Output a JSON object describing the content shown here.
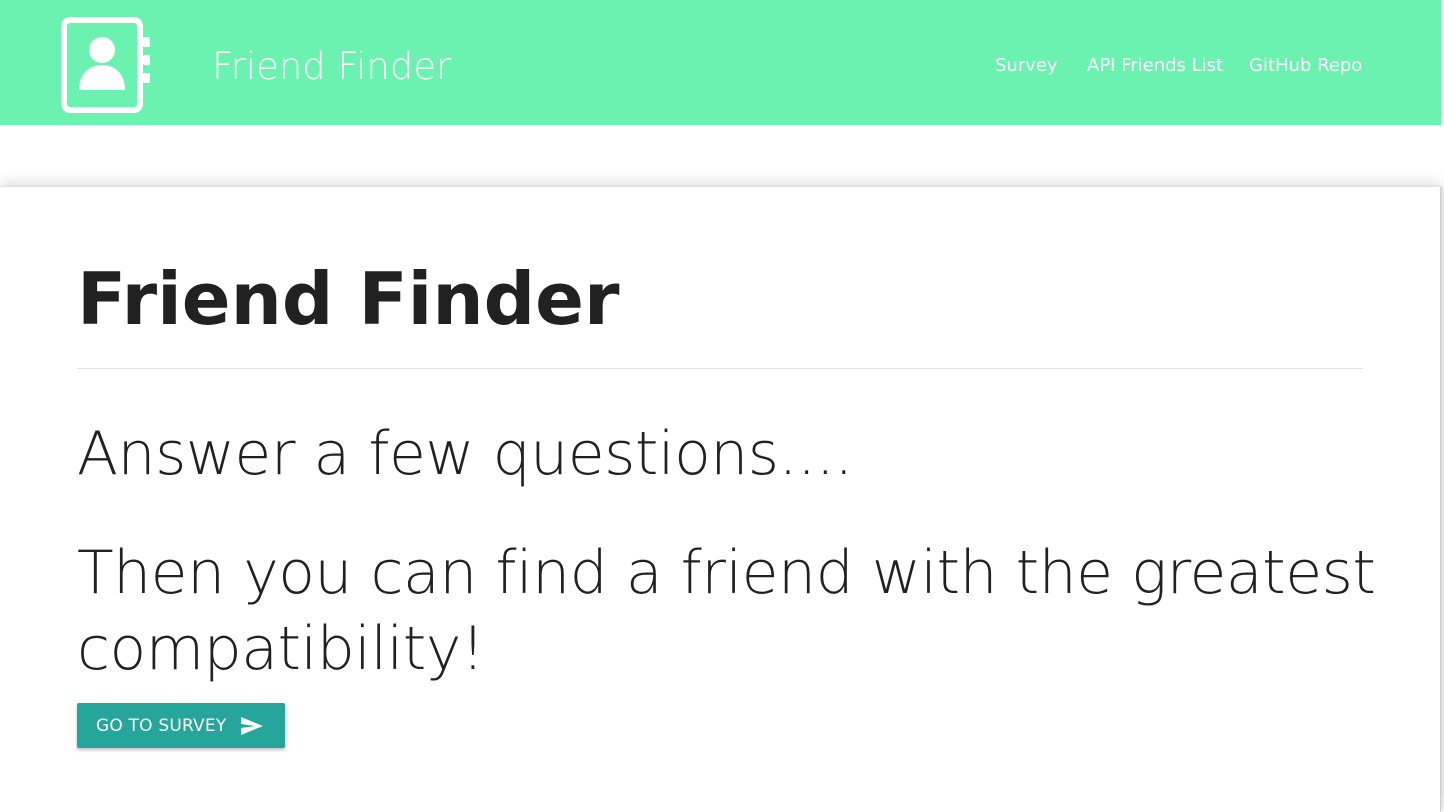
{
  "navbar": {
    "brand_title": "Friend Finder",
    "brand_icon": "contact-book-icon",
    "links": [
      {
        "label": "Survey"
      },
      {
        "label": "API Friends List"
      },
      {
        "label": "GitHub Repo"
      }
    ],
    "background_color": "#6bf1b0"
  },
  "main": {
    "title": "Friend Finder",
    "lead_1": "Answer a few questions....",
    "lead_2": "Then you can find a friend with the greatest compatibility!",
    "button": {
      "label": "GO TO SURVEY",
      "icon": "send-icon",
      "color": "#26a69a"
    }
  }
}
